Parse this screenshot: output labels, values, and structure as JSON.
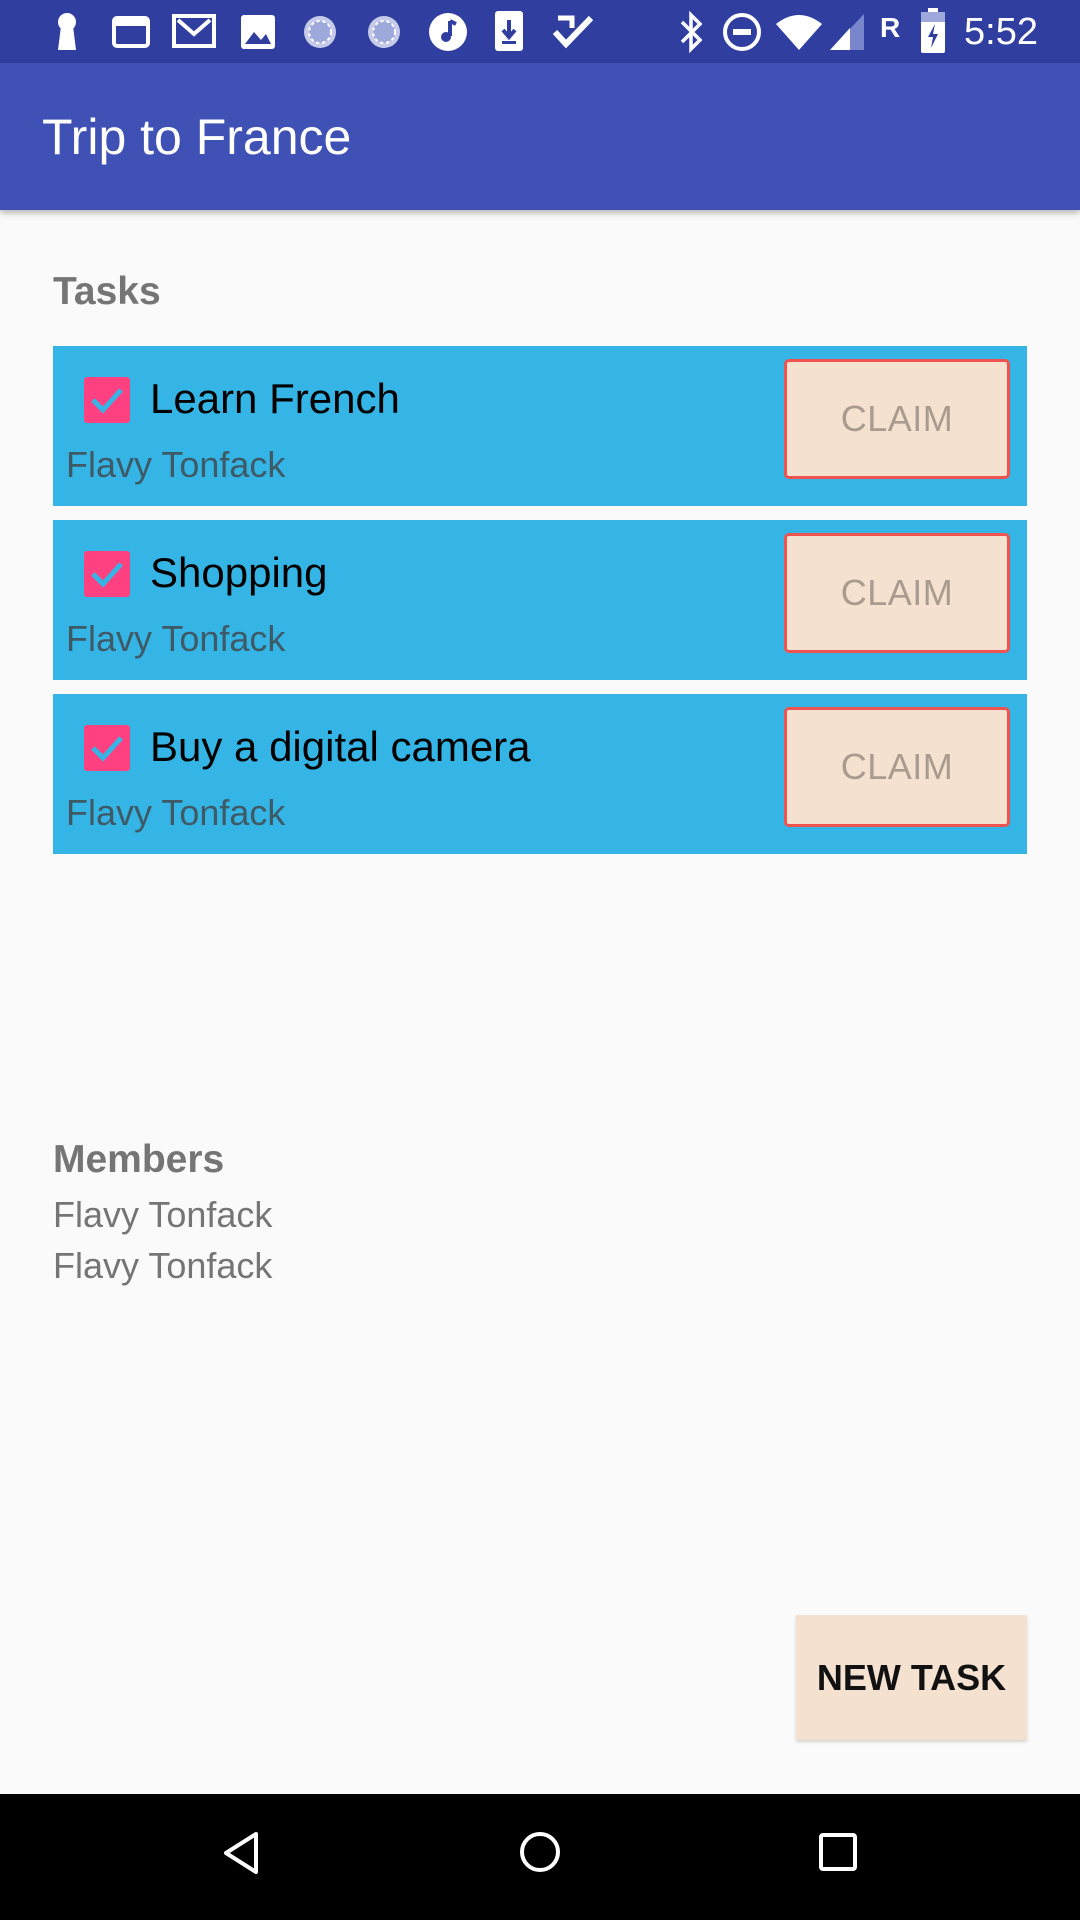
{
  "status_bar": {
    "time": "5:52",
    "network_label": "R",
    "left_icons": [
      "keyhole-icon",
      "window-icon",
      "gmail-icon",
      "image-icon",
      "loading-icon",
      "loading-icon",
      "music-icon",
      "download-icon",
      "check-icon"
    ],
    "right_icons": [
      "bluetooth-icon",
      "do-not-disturb-icon",
      "wifi-icon",
      "signal-icon",
      "battery-charging-icon"
    ]
  },
  "app_bar": {
    "title": "Trip to France"
  },
  "tasks": {
    "heading": "Tasks",
    "items": [
      {
        "title": "Learn French",
        "owner": "Flavy Tonfack",
        "checked": true,
        "action": "CLAIM"
      },
      {
        "title": "Shopping",
        "owner": "Flavy Tonfack",
        "checked": true,
        "action": "CLAIM"
      },
      {
        "title": "Buy a digital camera",
        "owner": "Flavy Tonfack",
        "checked": true,
        "action": "CLAIM"
      }
    ]
  },
  "members": {
    "heading": "Members",
    "items": [
      "Flavy Tonfack",
      "Flavy Tonfack"
    ]
  },
  "new_task_button": {
    "label": "NEW TASK"
  },
  "nav_bar": {
    "icons": [
      "back-icon",
      "home-icon",
      "recents-icon"
    ]
  },
  "colors": {
    "status_bar": "#303f9f",
    "app_bar": "#3f51b5",
    "task_card": "#35b5e5",
    "checkbox": "#ff4081",
    "button_bg": "#f5e1cf",
    "claim_border": "#ef5350"
  }
}
